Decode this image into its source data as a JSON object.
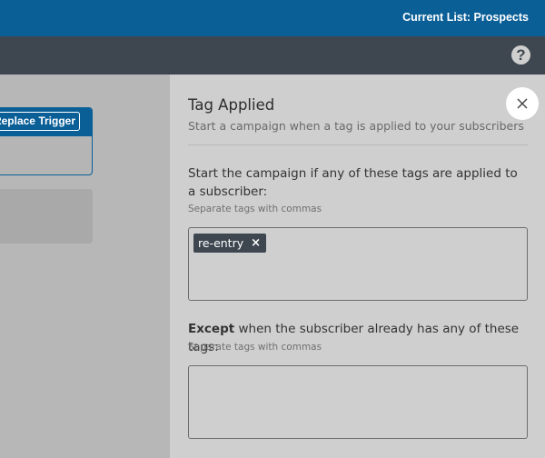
{
  "header": {
    "current_list": "Current List: Prospects"
  },
  "subheader": {
    "help_icon": "question-circle-icon",
    "help_glyph": "?"
  },
  "trigger_card": {
    "replace_label": "Replace Trigger"
  },
  "panel": {
    "title": "Tag Applied",
    "subtitle": "Start a campaign when a tag is applied to your subscribers",
    "close_icon": "close-icon",
    "include_section": {
      "label": "Start the campaign if any of these tags are applied to a subscriber:",
      "hint": "Separate tags with commas",
      "tags": [
        {
          "label": "re-entry",
          "remove_glyph": "×"
        }
      ]
    },
    "except_section": {
      "label_bold": "Except",
      "label_rest": " when the subscriber already has any of these tags:",
      "hint": "Separate tags with commas",
      "tags": []
    }
  },
  "colors": {
    "brand_blue": "#0a5f97",
    "dark_bar": "#3e4750",
    "overlay_gray": "#cfcfcf"
  }
}
